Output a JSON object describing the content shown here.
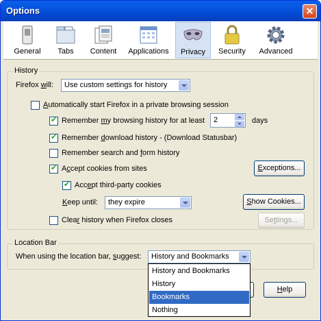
{
  "window": {
    "title": "Options",
    "close_glyph": "✕"
  },
  "toolbar": {
    "items": [
      {
        "label": "General",
        "icon": "switch-icon"
      },
      {
        "label": "Tabs",
        "icon": "tabs-icon"
      },
      {
        "label": "Content",
        "icon": "content-icon"
      },
      {
        "label": "Applications",
        "icon": "applications-icon"
      },
      {
        "label": "Privacy",
        "icon": "privacy-mask-icon",
        "selected": true
      },
      {
        "label": "Security",
        "icon": "padlock-icon"
      },
      {
        "label": "Advanced",
        "icon": "gear-icon"
      }
    ]
  },
  "history": {
    "group_label": "History",
    "firefox_will_prefix": "Firefox ",
    "firefox_will_accel": "w",
    "firefox_will_suffix": "ill:",
    "firefox_will_value": "Use custom settings for history",
    "private_browsing": {
      "checked": false,
      "accel": "A",
      "rest": "utomatically start Firefox in a private browsing session"
    },
    "remember_browsing": {
      "checked": true,
      "pre": "Remember ",
      "accel": "m",
      "rest": "y browsing history for at least",
      "days_value": "2",
      "days_label": "days"
    },
    "remember_download": {
      "checked": true,
      "pre": "Remember ",
      "accel": "d",
      "rest": "ownload history - (Download Statusbar)"
    },
    "remember_search": {
      "checked": false,
      "pre": "Remember search and ",
      "accel": "f",
      "rest": "orm history"
    },
    "accept_cookies": {
      "checked": true,
      "pre": "A",
      "accel": "c",
      "rest": "cept cookies from sites",
      "exceptions_pre": "",
      "exceptions_accel": "E",
      "exceptions_rest": "xceptions..."
    },
    "third_party": {
      "checked": true,
      "pre": "Acc",
      "accel": "e",
      "rest": "pt third-party cookies"
    },
    "keep_until": {
      "accel": "K",
      "rest": "eep until:",
      "value": "they expire",
      "show_accel": "S",
      "show_rest": "how Cookies..."
    },
    "clear_history": {
      "checked": false,
      "pre": "Clea",
      "accel": "r",
      "rest": " history when Firefox closes",
      "settings_pre": "Se",
      "settings_accel": "t",
      "settings_rest": "tings..."
    }
  },
  "location_bar": {
    "group_label": "Location Bar",
    "suggest_pre": "When using the location bar, ",
    "suggest_accel": "s",
    "suggest_rest": "uggest:",
    "suggest_value": "History and Bookmarks",
    "options": [
      "History and Bookmarks",
      "History",
      "Bookmarks",
      "Nothing"
    ],
    "highlighted_option": "Bookmarks"
  },
  "buttons": {
    "help_accel": "H",
    "help_rest": "elp"
  },
  "colors": {
    "title_bar": "#0554e0",
    "dialog_bg": "#ece9d8",
    "highlight": "#316ac5",
    "check_green": "#21a121"
  }
}
